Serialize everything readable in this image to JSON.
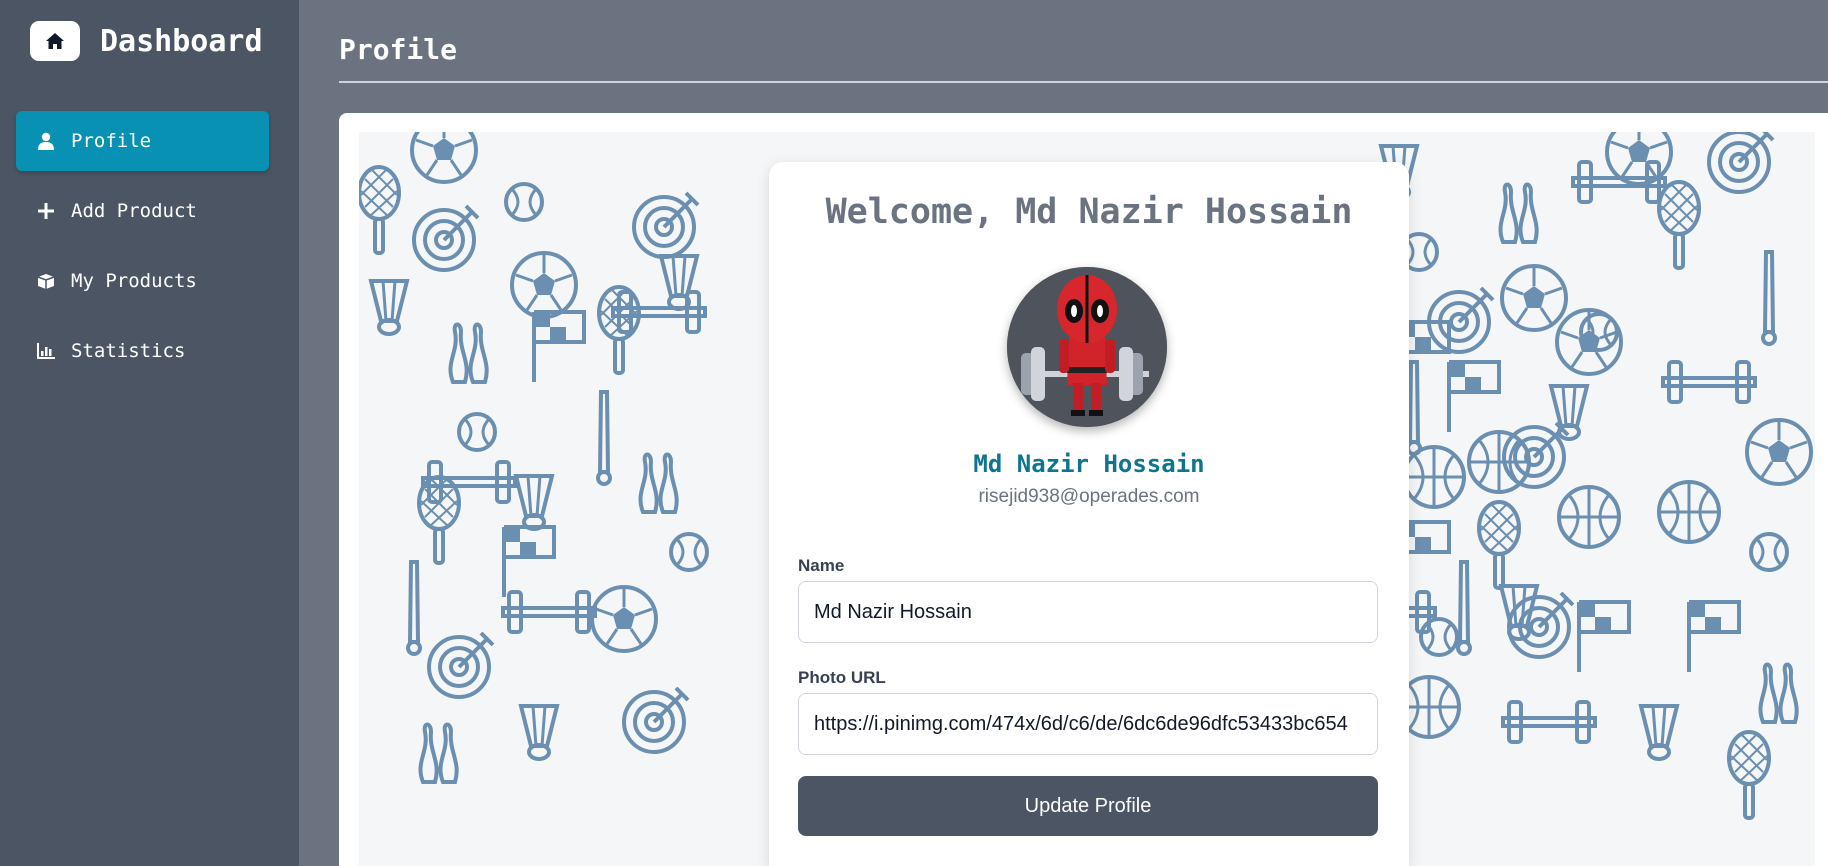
{
  "app": {
    "brand_title": "Dashboard",
    "brand_icon": "home-icon"
  },
  "sidebar": {
    "items": [
      {
        "label": "Profile",
        "icon": "user-icon",
        "active": true
      },
      {
        "label": "Add Product",
        "icon": "plus-icon",
        "active": false
      },
      {
        "label": "My Products",
        "icon": "box-icon",
        "active": false
      },
      {
        "label": "Statistics",
        "icon": "bar-chart-icon",
        "active": false
      }
    ]
  },
  "header": {
    "title": "Profile"
  },
  "profile": {
    "welcome": "Welcome, Md Nazir Hossain",
    "name": "Md Nazir Hossain",
    "email": "risejid938@operades.com"
  },
  "form": {
    "name_label": "Name",
    "name_value": "Md Nazir Hossain",
    "photo_label": "Photo URL",
    "photo_value": "https://i.pinimg.com/474x/6d/c6/de/6dc6de96dfc53433bc654",
    "submit_label": "Update Profile"
  },
  "colors": {
    "sidebar_bg": "#4b5563",
    "main_bg": "#6b7280",
    "accent": "#0891b2",
    "name_color": "#0e7490",
    "button_bg": "#4b5563"
  }
}
